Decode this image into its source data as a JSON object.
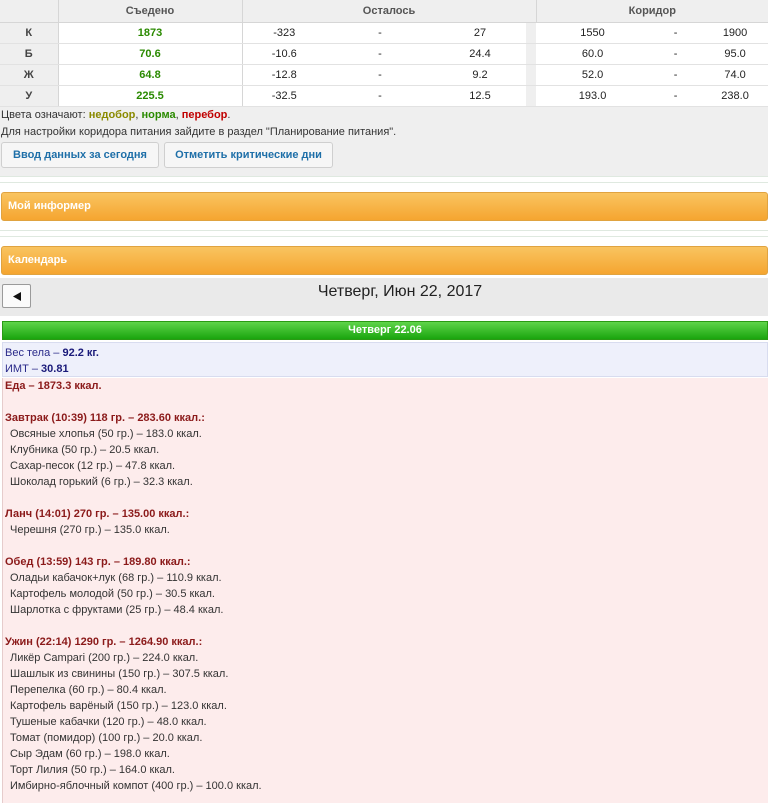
{
  "nutrition": {
    "headers": {
      "eaten": "Съедено",
      "remaining": "Осталось",
      "corridor": "Коридор"
    },
    "rows": [
      {
        "label": "К",
        "eaten": "1873",
        "remaining_from": "-323",
        "remaining_sep": "-",
        "remaining_to": "27",
        "corridor_from": "1550",
        "corridor_sep": "-",
        "corridor_to": "1900"
      },
      {
        "label": "Б",
        "eaten": "70.6",
        "remaining_from": "-10.6",
        "remaining_sep": "-",
        "remaining_to": "24.4",
        "corridor_from": "60.0",
        "corridor_sep": "-",
        "corridor_to": "95.0"
      },
      {
        "label": "Ж",
        "eaten": "64.8",
        "remaining_from": "-12.8",
        "remaining_sep": "-",
        "remaining_to": "9.2",
        "corridor_from": "52.0",
        "corridor_sep": "-",
        "corridor_to": "74.0"
      },
      {
        "label": "У",
        "eaten": "225.5",
        "remaining_from": "-32.5",
        "remaining_sep": "-",
        "remaining_to": "12.5",
        "corridor_from": "193.0",
        "corridor_sep": "-",
        "corridor_to": "238.0"
      }
    ],
    "colors_eaten": "#2a8a00"
  },
  "legend": {
    "prefix": "Цвета означают: ",
    "under": "недобор",
    "sep1": ", ",
    "norm": "норма",
    "sep2": ", ",
    "over": "перебор",
    "end": ".",
    "colors": {
      "under": "#8a8a00",
      "norm": "#2a8a00",
      "over": "#c00000"
    }
  },
  "hint": "Для настройки коридора питания зайдите в раздел \"Планирование питания\".",
  "buttons": {
    "today": "Ввод данных за сегодня",
    "critical": "Отметить критические дни"
  },
  "panels": {
    "informer": "Мой информер",
    "calendar": "Календарь",
    "accent": "#f5a530"
  },
  "calendar": {
    "back_icon": "left-triangle-icon",
    "date_title": "Четверг, Июн 22, 2017",
    "day_label": "Четверг 22.06",
    "day_color": "#1aa50e"
  },
  "body": {
    "weight_label": "Вес тела",
    "weight_sep": " – ",
    "weight_value": "92.2 кг.",
    "bmi_label": "ИМТ",
    "bmi_sep": " – ",
    "bmi_value": "30.81"
  },
  "food": {
    "total": "Еда – 1873.3 ккал.",
    "meals": [
      {
        "header": "Завтрак (10:39) 118 гр. – 283.60 ккал.:",
        "items": [
          "Овсяные хлопья (50 гр.) – 183.0 ккал.",
          "Клубника (50 гр.) – 20.5 ккал.",
          "Сахар-песок (12 гр.) – 47.8 ккал.",
          "Шоколад горький (6 гр.) – 32.3 ккал."
        ]
      },
      {
        "header": "Ланч (14:01) 270 гр. – 135.00 ккал.:",
        "items": [
          "Черешня (270 гр.) – 135.0 ккал."
        ]
      },
      {
        "header": "Обед (13:59) 143 гр. – 189.80 ккал.:",
        "items": [
          "Оладьи кабачок+лук (68 гр.) – 110.9 ккал.",
          "Картофель молодой (50 гр.) – 30.5 ккал.",
          "Шарлотка с фруктами (25 гр.) – 48.4 ккал."
        ]
      },
      {
        "header": "Ужин (22:14) 1290 гр. – 1264.90 ккал.:",
        "items": [
          "Ликёр Campari (200 гр.) – 224.0 ккал.",
          "Шашлык из свинины (150 гр.) – 307.5 ккал.",
          "Перепелка (60 гр.) – 80.4 ккал.",
          "Картофель варёный (150 гр.) – 123.0 ккал.",
          "Тушеные кабачки (120 гр.) – 48.0 ккал.",
          "Томат (помидор) (100 гр.) – 20.0 ккал.",
          "Сыр Эдам (60 гр.) – 198.0 ккал.",
          "Торт Лилия (50 гр.) – 164.0 ккал.",
          "Имбирно-яблочный компот (400 гр.) – 100.0 ккал."
        ]
      }
    ]
  }
}
